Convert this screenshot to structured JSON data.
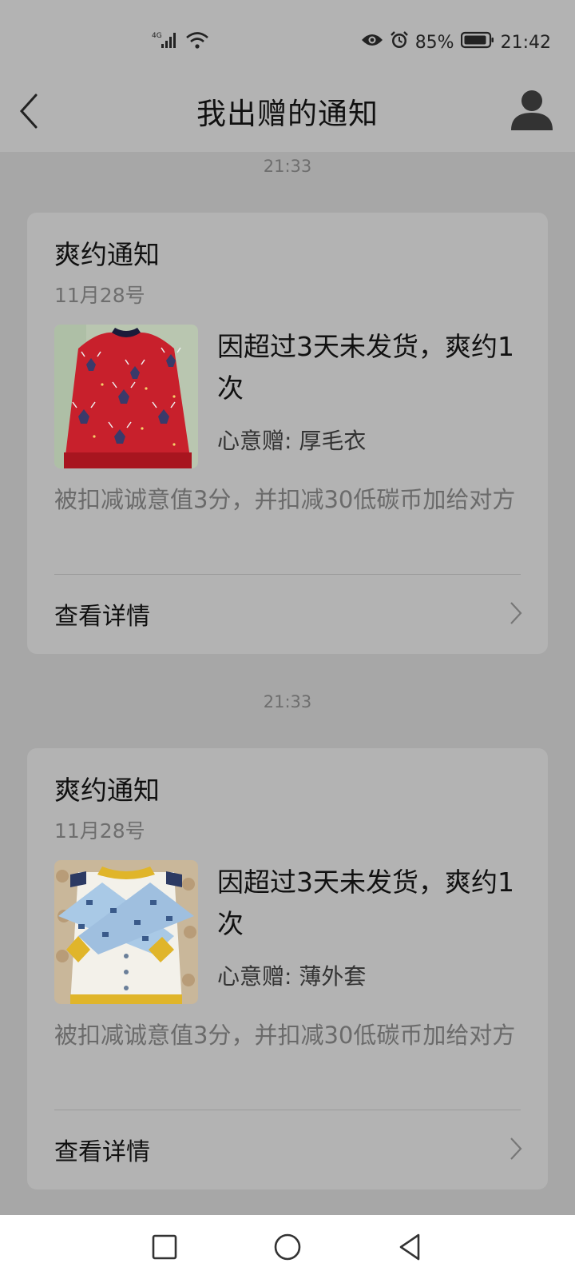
{
  "status_bar": {
    "network": "4G",
    "battery_percent": "85%",
    "time": "21:42"
  },
  "header": {
    "title": "我出赠的通知"
  },
  "messages": [
    {
      "timestamp": "21:33",
      "title": "爽约通知",
      "date": "11月28号",
      "reason": "因超过3天未发货，爽约1次",
      "gift_prefix": "心意赠: ",
      "gift_name": "厚毛衣",
      "penalty": "被扣减诚意值3分，并扣减30低碳币加给对方",
      "detail_label": "查看详情"
    },
    {
      "timestamp": "21:33",
      "title": "爽约通知",
      "date": "11月28号",
      "reason": "因超过3天未发货，爽约1次",
      "gift_prefix": "心意赠: ",
      "gift_name": "薄外套",
      "penalty": "被扣减诚意值3分，并扣减30低碳币加给对方",
      "detail_label": "查看详情"
    }
  ],
  "colors": {
    "background": "#a7a7a7",
    "card": "#b3b3b3",
    "sweater_red": "#c8202c",
    "jacket_blue": "#a9c9e6"
  }
}
